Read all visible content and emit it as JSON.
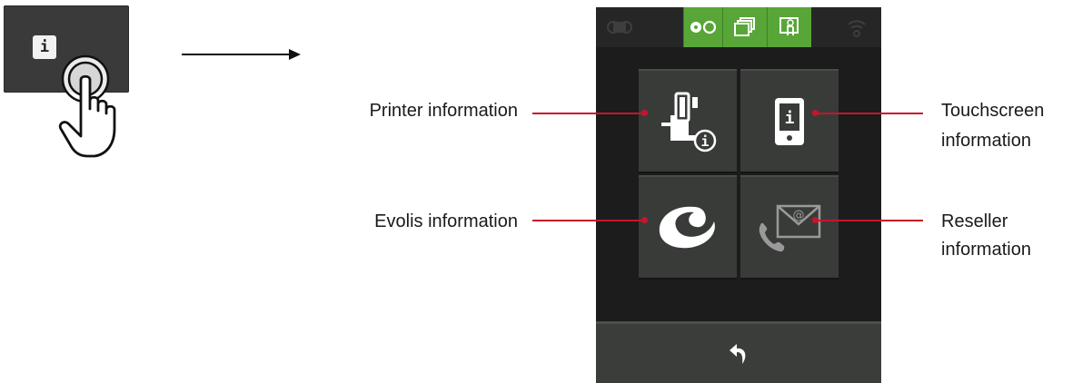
{
  "left_illustration": {
    "button_glyph": "i",
    "button_icon": "info-icon",
    "hand_icon": "tapping-hand-icon",
    "arrow_icon": "right-arrow-icon"
  },
  "screen": {
    "status_bar": {
      "tabs": [
        {
          "icon": "ribbon-icon",
          "active": false
        },
        {
          "icon": "ribbon-loaded-icon",
          "active": true
        },
        {
          "icon": "cards-stack-icon",
          "active": true
        },
        {
          "icon": "card-touch-icon",
          "active": true
        },
        {
          "icon": "wifi-icon",
          "active": false
        }
      ],
      "active_color": "#58a637"
    },
    "tiles": [
      {
        "id": "printer-info",
        "icon": "printer-info-icon",
        "info_glyph": "i"
      },
      {
        "id": "touchscreen-info",
        "icon": "touchscreen-info-icon",
        "info_glyph": "i"
      },
      {
        "id": "evolis-info",
        "icon": "evolis-logo-icon"
      },
      {
        "id": "reseller-info",
        "icon": "reseller-contact-icon",
        "at_glyph": "@"
      }
    ],
    "bottom_bar": {
      "icon": "back-arrow-icon"
    }
  },
  "callouts": {
    "printer": "Printer information",
    "touchscreen_line1": "Touchscreen",
    "touchscreen_line2": "information",
    "evolis": "Evolis information",
    "reseller_line1": "Reseller",
    "reseller_line2": "information",
    "line_color": "#c8142a"
  }
}
